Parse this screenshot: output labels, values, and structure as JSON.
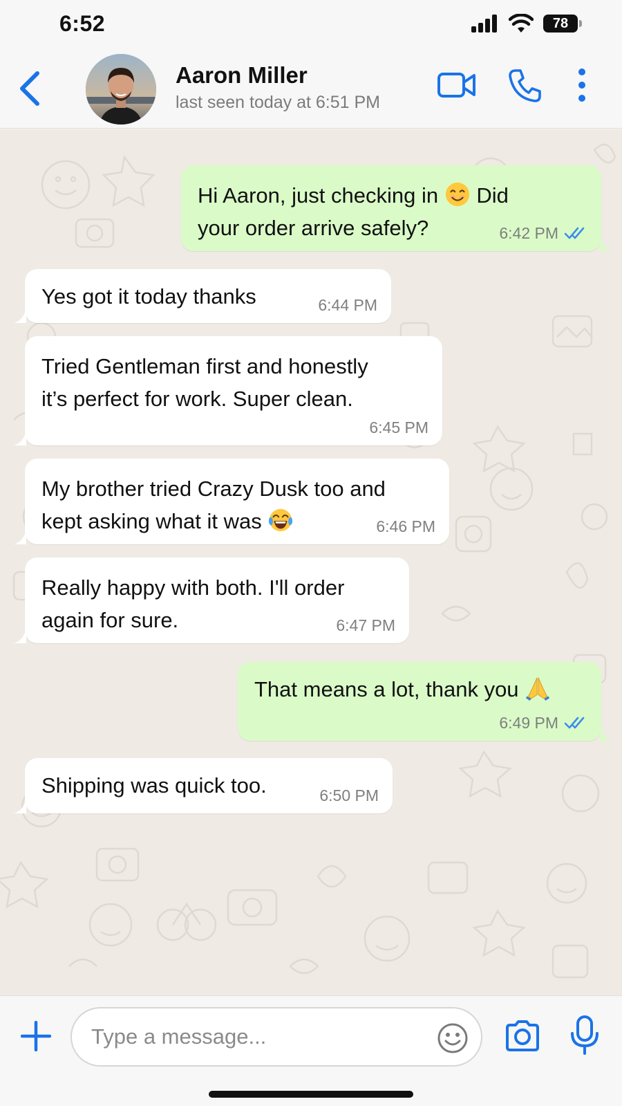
{
  "status_bar": {
    "time": "6:52",
    "battery": "78"
  },
  "header": {
    "contact_name": "Aaron Miller",
    "last_seen": "last seen today at 6:51 PM"
  },
  "messages": [
    {
      "direction": "out",
      "line1": "Hi Aaron, just checking in",
      "emoji": "smiling-face-emoji",
      "line1_end": "Did",
      "line2": "your order arrive safely?",
      "time": "6:42 PM",
      "status": "read"
    },
    {
      "direction": "in",
      "text": "Yes got it today thanks",
      "time": "6:44 PM"
    },
    {
      "direction": "in",
      "line1": "Tried Gentleman first and honestly",
      "line2": "it’s perfect for work. Super clean.",
      "time": "6:45 PM"
    },
    {
      "direction": "in",
      "line1": "My brother tried Crazy Dusk too and",
      "line2": "kept asking what it was",
      "emoji": "tears-of-joy-emoji",
      "time": "6:46 PM"
    },
    {
      "direction": "in",
      "line1": "Really happy with both. I'll order",
      "line2": "again for sure.",
      "time": "6:47 PM"
    },
    {
      "direction": "out",
      "text": "That means a lot, thank you",
      "emoji": "folded-hands-emoji",
      "time": "6:49 PM",
      "status": "read"
    },
    {
      "direction": "in",
      "text": "Shipping was quick too.",
      "time": "6:50 PM"
    }
  ],
  "composer": {
    "placeholder": "Type a message..."
  },
  "colors": {
    "accent": "#1a73e8",
    "outgoing_bubble": "#dafbc8",
    "incoming_bubble": "#ffffff",
    "read_ticks": "#3b8ee8",
    "wallpaper": "#efebe4"
  }
}
